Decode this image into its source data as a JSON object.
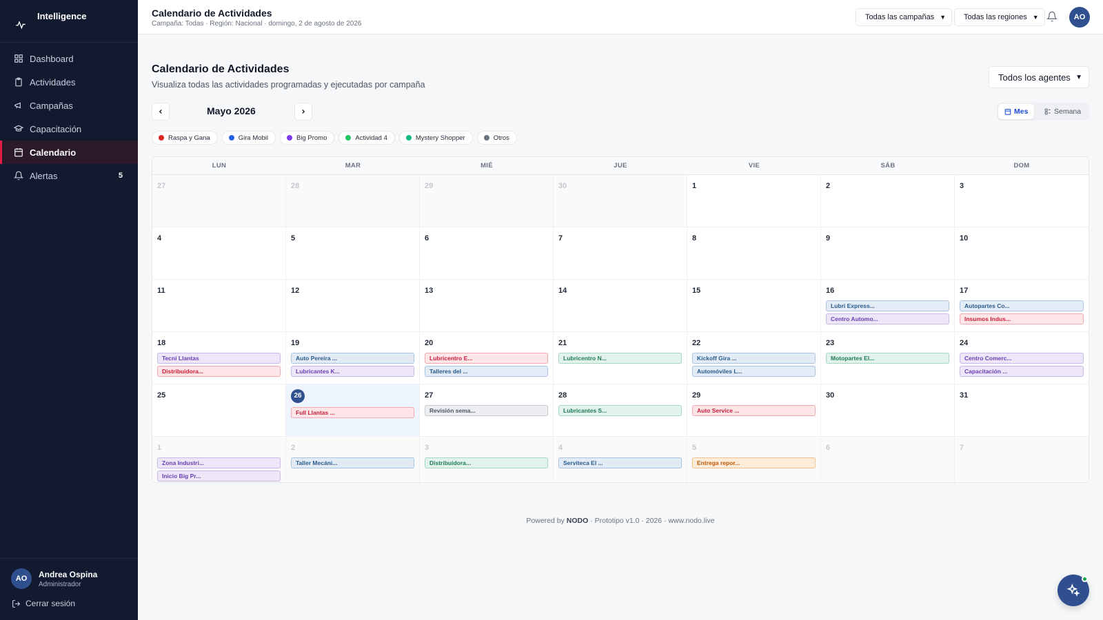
{
  "app": {
    "brand": "Intelligence"
  },
  "sidebar": {
    "items": [
      {
        "label": "Dashboard",
        "icon": "grid-icon",
        "active": false
      },
      {
        "label": "Actividades",
        "icon": "clipboard-icon",
        "active": false
      },
      {
        "label": "Campañas",
        "icon": "megaphone-icon",
        "active": false
      },
      {
        "label": "Capacitación",
        "icon": "graduation-cap-icon",
        "active": false
      },
      {
        "label": "Calendario",
        "icon": "calendar-icon",
        "active": true
      },
      {
        "label": "Alertas",
        "icon": "bell-icon",
        "active": false,
        "badge": "5"
      }
    ],
    "user": {
      "initials": "AO",
      "name": "Andrea Ospina",
      "role": "Administrador"
    },
    "logout_label": "Cerrar sesión"
  },
  "topbar": {
    "title": "Calendario de Actividades",
    "subtitle": "Campaña: Todas · Región: Nacional · domingo, 2 de agosto de 2026",
    "campaign_filter": "Todas las campañas",
    "region_filter": "Todas las regiones",
    "avatar_initials": "AO"
  },
  "main": {
    "title": "Calendario de Actividades",
    "description": "Visualiza todas las actividades programadas y ejecutadas por campaña",
    "agent_filter": "Todos los agentes",
    "month_label": "Mayo 2026",
    "view_month": "Mes",
    "view_week": "Semana"
  },
  "legend": [
    {
      "label": "Raspa y Gana",
      "color": "#dc2626"
    },
    {
      "label": "Gira Mobil",
      "color": "#2563eb"
    },
    {
      "label": "Big Promo",
      "color": "#7c3aed"
    },
    {
      "label": "Actividad 4",
      "color": "#22c55e"
    },
    {
      "label": "Mystery Shopper",
      "color": "#10b981"
    },
    {
      "label": "Otros",
      "color": "#6b7280"
    }
  ],
  "calendar": {
    "weekdays": [
      "LUN",
      "MAR",
      "MIÉ",
      "JUE",
      "VIE",
      "SÁB",
      "DOM"
    ],
    "days": [
      {
        "num": "27",
        "out": true,
        "events": []
      },
      {
        "num": "28",
        "out": true,
        "events": []
      },
      {
        "num": "29",
        "out": true,
        "events": []
      },
      {
        "num": "30",
        "out": true,
        "events": []
      },
      {
        "num": "1",
        "events": []
      },
      {
        "num": "2",
        "events": []
      },
      {
        "num": "3",
        "events": []
      },
      {
        "num": "4",
        "events": []
      },
      {
        "num": "5",
        "events": []
      },
      {
        "num": "6",
        "events": []
      },
      {
        "num": "7",
        "events": []
      },
      {
        "num": "8",
        "events": []
      },
      {
        "num": "9",
        "events": []
      },
      {
        "num": "10",
        "events": []
      },
      {
        "num": "11",
        "events": []
      },
      {
        "num": "12",
        "events": []
      },
      {
        "num": "13",
        "events": []
      },
      {
        "num": "14",
        "events": []
      },
      {
        "num": "15",
        "events": []
      },
      {
        "num": "16",
        "events": [
          {
            "label": "Lubri Express...",
            "color": "blue"
          },
          {
            "label": "Centro Automo...",
            "color": "purple"
          }
        ]
      },
      {
        "num": "17",
        "events": [
          {
            "label": "Autopartes Co...",
            "color": "blue"
          },
          {
            "label": "Insumos Indus...",
            "color": "red"
          }
        ]
      },
      {
        "num": "18",
        "events": [
          {
            "label": "Tecni Llantas",
            "color": "purple"
          },
          {
            "label": "Distribuidora...",
            "color": "red"
          }
        ]
      },
      {
        "num": "19",
        "events": [
          {
            "label": "Auto Pereira ...",
            "color": "blue"
          },
          {
            "label": "Lubricantes K...",
            "color": "purple"
          }
        ]
      },
      {
        "num": "20",
        "events": [
          {
            "label": "Lubricentro E...",
            "color": "red"
          },
          {
            "label": "Talleres del ...",
            "color": "blue"
          }
        ]
      },
      {
        "num": "21",
        "events": [
          {
            "label": "Lubricentro N...",
            "color": "green"
          }
        ]
      },
      {
        "num": "22",
        "events": [
          {
            "label": "Kickoff Gira ...",
            "color": "blue"
          },
          {
            "label": "Automóviles L...",
            "color": "blue"
          }
        ]
      },
      {
        "num": "23",
        "events": [
          {
            "label": "Motopartes El...",
            "color": "green"
          }
        ]
      },
      {
        "num": "24",
        "events": [
          {
            "label": "Centro Comerc...",
            "color": "purple"
          },
          {
            "label": "Capacitación ...",
            "color": "purple"
          }
        ]
      },
      {
        "num": "25",
        "events": []
      },
      {
        "num": "26",
        "today": true,
        "events": [
          {
            "label": "Full Llantas ...",
            "color": "red"
          }
        ]
      },
      {
        "num": "27",
        "events": [
          {
            "label": "Revisión sema...",
            "color": "gray"
          }
        ]
      },
      {
        "num": "28",
        "events": [
          {
            "label": "Lubricantes S...",
            "color": "green"
          }
        ]
      },
      {
        "num": "29",
        "events": [
          {
            "label": "Auto Service ...",
            "color": "red"
          }
        ]
      },
      {
        "num": "30",
        "events": []
      },
      {
        "num": "31",
        "events": []
      },
      {
        "num": "1",
        "out": true,
        "events": [
          {
            "label": "Zona Industri...",
            "color": "purple"
          },
          {
            "label": "Inicio Big Pr...",
            "color": "purple"
          }
        ]
      },
      {
        "num": "2",
        "out": true,
        "events": [
          {
            "label": "Taller Mecáni...",
            "color": "blue"
          }
        ]
      },
      {
        "num": "3",
        "out": true,
        "events": [
          {
            "label": "Distribuidora...",
            "color": "green"
          }
        ]
      },
      {
        "num": "4",
        "out": true,
        "events": [
          {
            "label": "Serviteca El ...",
            "color": "blue"
          }
        ]
      },
      {
        "num": "5",
        "out": true,
        "events": [
          {
            "label": "Entrega repor...",
            "color": "orange"
          }
        ]
      },
      {
        "num": "6",
        "out": true,
        "events": []
      },
      {
        "num": "7",
        "out": true,
        "events": []
      }
    ]
  },
  "footer": {
    "prefix": "Powered by",
    "brand": "NODO",
    "suffix": "· Prototipo v1.0 · 2026 · www.nodo.live"
  }
}
